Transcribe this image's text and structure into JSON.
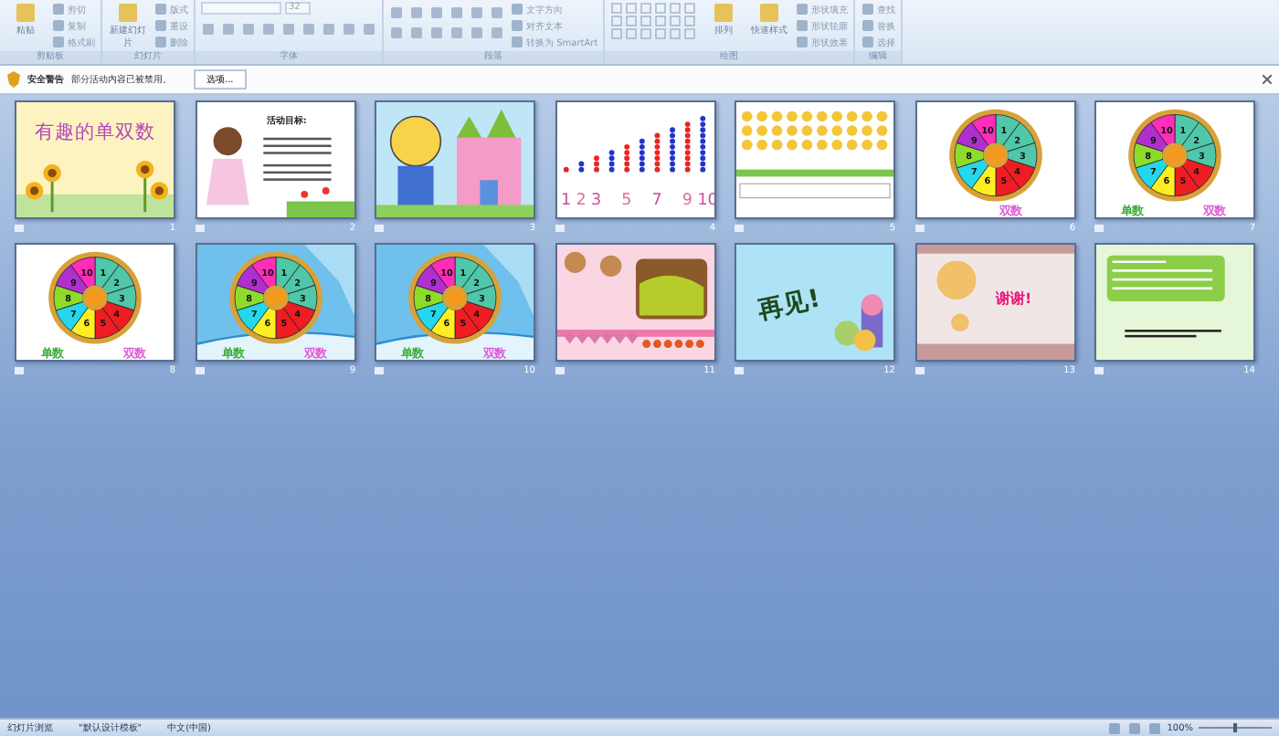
{
  "ribbon": {
    "groups": [
      {
        "kind": "clipboard",
        "label": "剪贴板",
        "large": "粘贴",
        "small": [
          "剪切",
          "复制",
          "格式刷"
        ]
      },
      {
        "kind": "slides",
        "label": "幻灯片",
        "large": "新建幻灯片",
        "small": [
          "版式",
          "重设",
          "删除"
        ]
      },
      {
        "kind": "font",
        "label": "字体",
        "size": "32"
      },
      {
        "kind": "paragraph",
        "label": "段落",
        "small": [
          "文字方向",
          "对齐文本",
          "转换为 SmartArt"
        ]
      },
      {
        "kind": "drawing",
        "label": "绘图",
        "large": "排列",
        "large2": "快速样式",
        "small": [
          "形状填充",
          "形状轮廓",
          "形状效果"
        ]
      },
      {
        "kind": "editing",
        "label": "编辑",
        "small": [
          "查找",
          "替换",
          "选择"
        ]
      }
    ]
  },
  "message_bar": {
    "title": "安全警告",
    "text": "部分活动内容已被禁用。",
    "button": "选项..."
  },
  "slides": [
    {
      "kind": "title",
      "number": "1",
      "title": "有趣的单双数"
    },
    {
      "kind": "objectives",
      "number": "2",
      "title": "活动目标:"
    },
    {
      "kind": "tiger",
      "number": "3"
    },
    {
      "kind": "beads",
      "number": "4",
      "numbers": [
        "1",
        "2",
        "3",
        "5",
        "7",
        "9",
        "10"
      ]
    },
    {
      "kind": "grid",
      "number": "5"
    },
    {
      "kind": "wheel",
      "number": "6",
      "segments": [
        "1",
        "2",
        "3",
        "4",
        "5",
        "6",
        "7",
        "8",
        "9",
        "10"
      ],
      "labels": [
        "双数"
      ]
    },
    {
      "kind": "wheel",
      "number": "7",
      "segments": [
        "1",
        "2",
        "3",
        "4",
        "5",
        "6",
        "7",
        "8",
        "9",
        "10"
      ],
      "labels": [
        "单数",
        "双数"
      ]
    },
    {
      "kind": "wheel",
      "number": "8",
      "segments": [
        "1",
        "2",
        "3",
        "4",
        "5",
        "6",
        "7",
        "8",
        "9",
        "10"
      ],
      "labels": [
        "单数",
        "双数"
      ]
    },
    {
      "kind": "sky_wheel",
      "number": "9",
      "segments": [
        "1",
        "2",
        "3",
        "4",
        "5",
        "6",
        "7",
        "8",
        "9",
        "10"
      ],
      "labels": [
        "单数",
        "双数"
      ]
    },
    {
      "kind": "sky_wheel",
      "number": "10",
      "segments": [
        "1",
        "2",
        "3",
        "4",
        "5",
        "6",
        "7",
        "8",
        "9",
        "10"
      ],
      "labels": [
        "单数",
        "双数"
      ]
    },
    {
      "kind": "bears",
      "number": "11"
    },
    {
      "kind": "goodbye",
      "number": "12",
      "title": "再见!"
    },
    {
      "kind": "thanks",
      "number": "13",
      "title": "谢谢!"
    },
    {
      "kind": "green",
      "number": "14"
    }
  ],
  "status_bar": {
    "view": "幻灯片浏览",
    "theme": "\"默认设计模板\"",
    "language": "中文(中国)",
    "zoom": "100%",
    "zoom_slider": {
      "level": 0.5
    }
  }
}
